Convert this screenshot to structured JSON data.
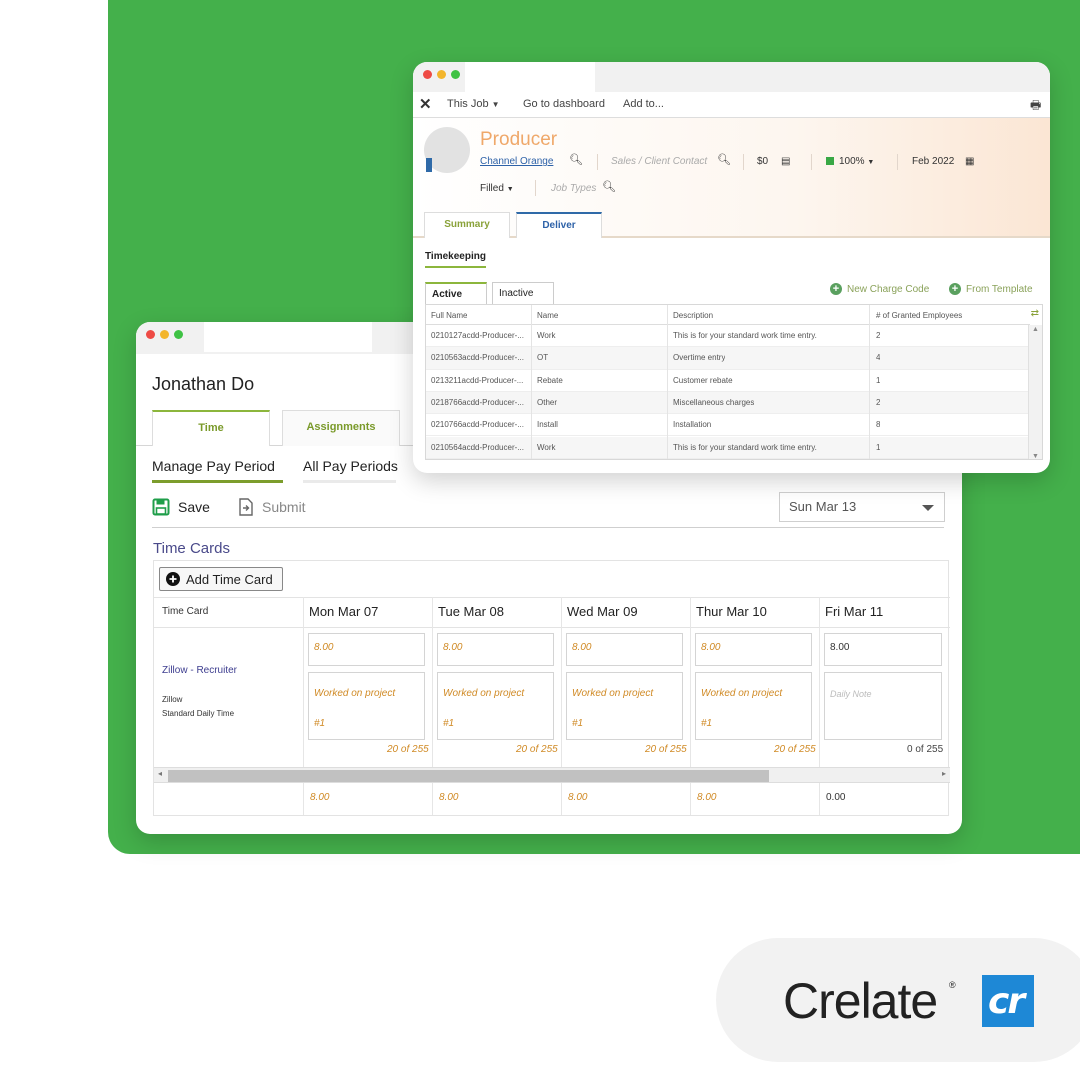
{
  "brand": {
    "name": "Crelate",
    "mark": "cr",
    "registered": "®",
    "colors": {
      "background_green": "#44b04b",
      "mark_blue": "#1e88d6",
      "accent_olive": "#7c9d2c",
      "producer_orange": "#efa86a"
    }
  },
  "time_window": {
    "person_name": "Jonathan Do",
    "tabs": [
      "Time",
      "Assignments"
    ],
    "sub_tabs": [
      "Manage Pay Period",
      "All Pay Periods"
    ],
    "toolbar": {
      "save": "Save",
      "submit": "Submit"
    },
    "period_select": "Sun Mar 13",
    "section_title": "Time Cards",
    "add_card": "Add Time Card",
    "first_col_header": "Time Card",
    "days": [
      {
        "label": "Mon Mar 07",
        "hours": "8.00",
        "note1": "Worked on project",
        "note2": "#1",
        "count": "20 of 255",
        "total": "8.00"
      },
      {
        "label": "Tue Mar 08",
        "hours": "8.00",
        "note1": "Worked on project",
        "note2": "#1",
        "count": "20 of 255",
        "total": "8.00"
      },
      {
        "label": "Wed Mar 09",
        "hours": "8.00",
        "note1": "Worked on project",
        "note2": "#1",
        "count": "20 of 255",
        "total": "8.00"
      },
      {
        "label": "Thur Mar 10",
        "hours": "8.00",
        "note1": "Worked on project",
        "note2": "#1",
        "count": "20 of 255",
        "total": "8.00"
      },
      {
        "label": "Fri Mar 11",
        "hours": "8.00",
        "note1": "Daily Note",
        "note2": "",
        "count": "0 of 255",
        "total": "0.00"
      }
    ],
    "card": {
      "link": "Zillow - Recruiter",
      "company": "Zillow",
      "type": "Standard Daily Time"
    }
  },
  "job_window": {
    "toolbar": {
      "this_job": "This Job",
      "dashboard": "Go to dashboard",
      "add_to": "Add to..."
    },
    "title": "Producer",
    "company_link": "Channel Orange",
    "contact_placeholder": "Sales / Client Contact",
    "amount": "$0",
    "percent": "100%",
    "date": "Feb 2022",
    "status": "Filled",
    "job_types_placeholder": "Job Types",
    "tabs": [
      "Summary",
      "Deliver"
    ],
    "section": "Timekeeping",
    "inner_tabs": [
      "Active",
      "Inactive"
    ],
    "actions": {
      "new_charge": "New Charge Code",
      "from_template": "From Template"
    },
    "table": {
      "headers": [
        "Full Name",
        "Name",
        "Description",
        "# of Granted Employees"
      ],
      "rows": [
        [
          "0210127acdd-Producer-...",
          "Work",
          "This is for your standard work time entry.",
          "2"
        ],
        [
          "0210563acdd-Producer-...",
          "OT",
          "Overtime entry",
          "4"
        ],
        [
          "0213211acdd-Producer-...",
          "Rebate",
          "Customer rebate",
          "1"
        ],
        [
          "0218766acdd-Producer-...",
          "Other",
          "Miscellaneous charges",
          "2"
        ],
        [
          "0210766acdd-Producer-...",
          "Install",
          "Installation",
          "8"
        ],
        [
          "0210564acdd-Producer-...",
          "Work",
          "This is for your standard work time entry.",
          "1"
        ]
      ]
    }
  }
}
